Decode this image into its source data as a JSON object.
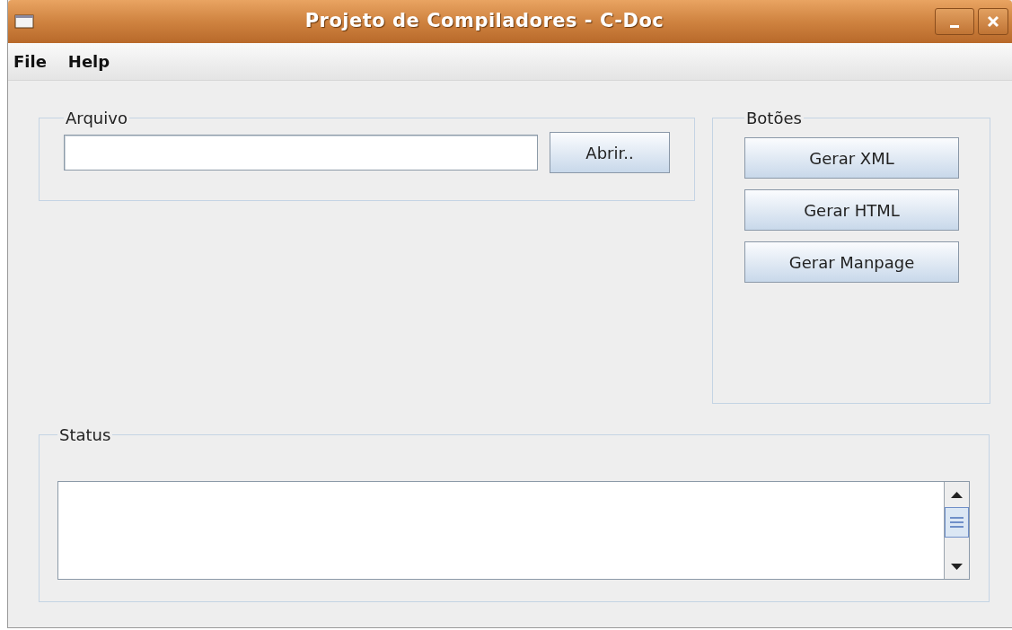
{
  "window": {
    "title": "Projeto de Compiladores - C-Doc"
  },
  "menu": [
    "File",
    "Help"
  ],
  "arquivo": {
    "legend": "Arquivo",
    "button": "Abrir.."
  },
  "botoes": {
    "legend": "Botões",
    "buttons": [
      "Gerar XML",
      "Gerar HTML",
      "Gerar Manpage"
    ]
  },
  "status": {
    "legend": "Status"
  }
}
